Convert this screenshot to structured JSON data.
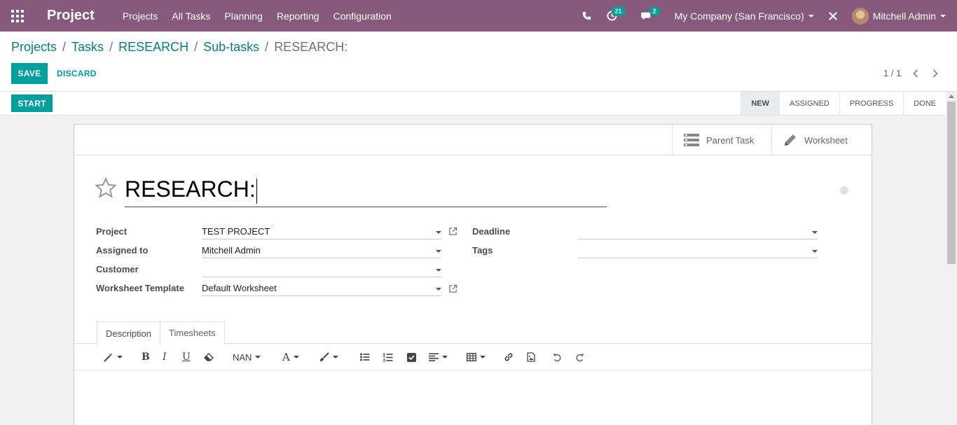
{
  "navbar": {
    "brand": "Project",
    "menu": [
      "Projects",
      "All Tasks",
      "Planning",
      "Reporting",
      "Configuration"
    ],
    "activity_count": "21",
    "message_count": "2",
    "company": "My Company (San Francisco)",
    "user": "Mitchell Admin"
  },
  "breadcrumb": {
    "items": [
      "Projects",
      "Tasks",
      "RESEARCH",
      "Sub-tasks"
    ],
    "current": "RESEARCH:"
  },
  "actions": {
    "save": "SAVE",
    "discard": "DISCARD"
  },
  "pager": {
    "text": "1 / 1"
  },
  "statusbar": {
    "start": "START",
    "stages": [
      "NEW",
      "ASSIGNED",
      "PROGRESS",
      "DONE"
    ],
    "active_stage": "NEW"
  },
  "smart_buttons": {
    "parent_task": "Parent Task",
    "worksheet": "Worksheet"
  },
  "form": {
    "title": "RESEARCH:",
    "labels": {
      "project": "Project",
      "assigned_to": "Assigned to",
      "customer": "Customer",
      "worksheet_template": "Worksheet Template",
      "deadline": "Deadline",
      "tags": "Tags"
    },
    "values": {
      "project": "TEST PROJECT",
      "assigned_to": "Mitchell Admin",
      "customer": "",
      "worksheet_template": "Default Worksheet",
      "deadline": "",
      "tags": ""
    }
  },
  "tabs": [
    "Description",
    "Timesheets"
  ],
  "editor": {
    "font_size": "NAN"
  },
  "colors": {
    "navbar": "#875a7b",
    "primary": "#00a09d",
    "link": "#00827f"
  }
}
